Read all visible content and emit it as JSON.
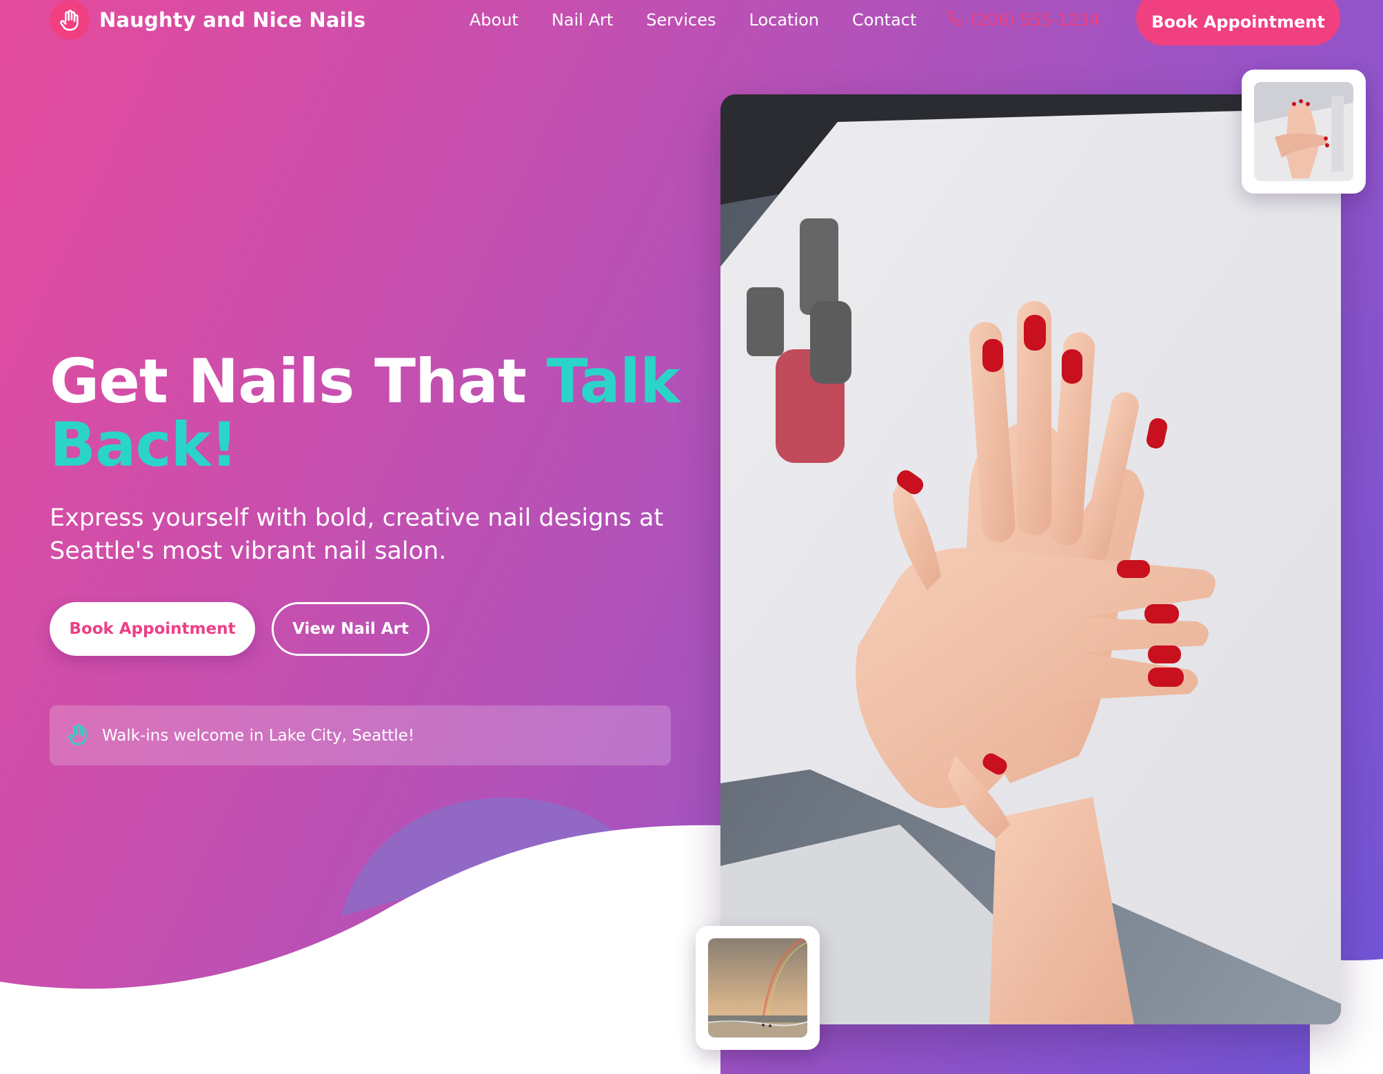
{
  "brand": {
    "name": "Naughty and Nice Nails",
    "logo_icon": "hand-icon",
    "logo_color": "#f0407f"
  },
  "nav": {
    "links": [
      "About",
      "Nail Art",
      "Services",
      "Location",
      "Contact"
    ],
    "phone": "(206) 555-1234",
    "phone_icon": "phone-icon",
    "cta": "Book Appointment"
  },
  "hero": {
    "headline_main": "Get Nails That ",
    "headline_accent": "Talk Back!",
    "subtext": "Express yourself with bold, creative nail designs at Seattle's most vibrant nail salon.",
    "primary_button": "Book Appointment",
    "secondary_button": "View Nail Art",
    "notice": "Walk-ins welcome in Lake City, Seattle!",
    "notice_icon": "hand-icon"
  },
  "images": {
    "main": "red-manicured-hands-photo",
    "thumb_top": "manicure-thumbnail",
    "thumb_bottom": "rainbow-beach-thumbnail"
  },
  "colors": {
    "brand_pink": "#f0407f",
    "accent_teal": "#2bd4c8",
    "gradient_start": "#e54b9c",
    "gradient_end": "#6f55d8"
  }
}
